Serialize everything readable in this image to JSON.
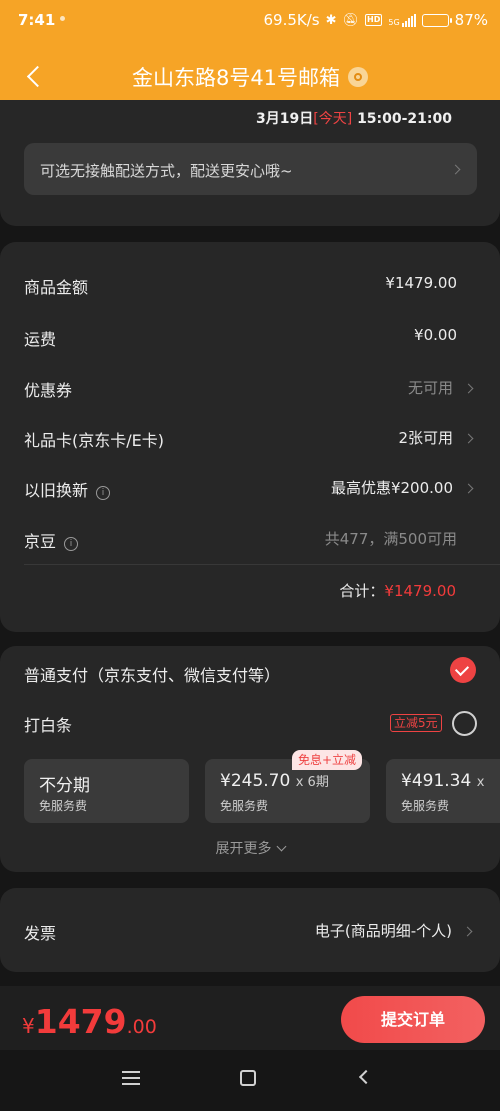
{
  "status_bar": {
    "time": "7:41",
    "network_speed": "69.5K/s",
    "network_type": "5G",
    "hd_label": "HD",
    "battery": "87%",
    "battery_level": 0.87,
    "icons": [
      "bluetooth-icon",
      "mute-icon",
      "hd-icon",
      "signal-icon",
      "battery-icon"
    ]
  },
  "header": {
    "title": "金山东路8号41号邮箱",
    "back_icon": "chevron-left-icon",
    "location_icon": "location-pin-icon"
  },
  "delivery": {
    "date": "3月19日",
    "today": "[今天]",
    "time_range": "15:00-21:00",
    "contactless_text": "可选无接触配送方式，配送更安心哦~"
  },
  "order_summary": {
    "rows": [
      {
        "label": "商品金额",
        "value": "¥1479.00"
      },
      {
        "label": "运费",
        "value": "¥0.00"
      },
      {
        "label": "优惠券",
        "value": "无可用"
      },
      {
        "label": "礼品卡(京东卡/E卡)",
        "value": "2张可用"
      },
      {
        "label": "以旧换新",
        "value": "最高优惠¥200.00"
      },
      {
        "label": "京豆",
        "value": "共477，满500可用"
      }
    ],
    "total_label": "合计：",
    "total_value": "¥1479.00"
  },
  "payment": {
    "standard_label": "普通支付（京东支付、微信支付等）",
    "standard_selected": true,
    "baitiao_label": "打白条",
    "baitiao_badge": "立减5元",
    "plan_tag": "免息+立减",
    "plans": [
      {
        "main": "不分期",
        "times": "",
        "sub": "免服务费"
      },
      {
        "main": "¥245.70",
        "times": "x 6期",
        "sub": "免服务费"
      },
      {
        "main": "¥491.34",
        "times": "x",
        "sub": "免服务费"
      }
    ],
    "expand_label": "展开更多"
  },
  "invoice": {
    "label": "发票",
    "value": "电子(商品明细-个人)"
  },
  "bottom": {
    "currency": "¥",
    "price_int": "1479",
    "price_dec": ".00",
    "submit_label": "提交订单"
  },
  "colors": {
    "header_bg": "#f6a426",
    "accent_red": "#ee4343",
    "card_bg": "#272727",
    "page_bg": "#161616"
  }
}
